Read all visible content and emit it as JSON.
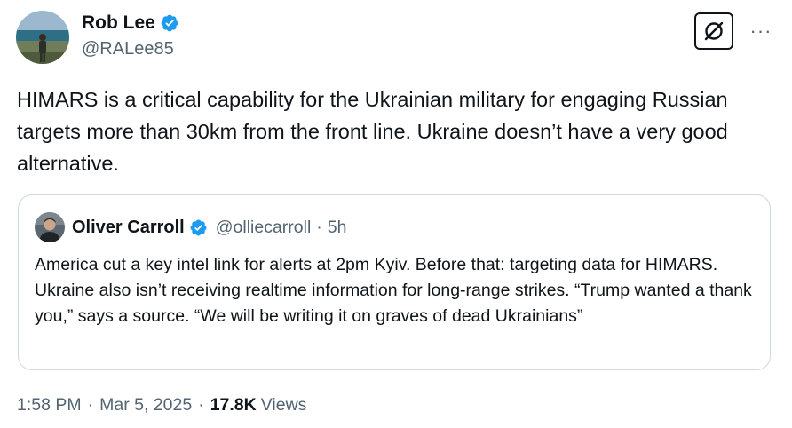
{
  "author": {
    "display_name": "Rob Lee",
    "handle": "@RALee85",
    "verified": true,
    "avatar_icon": "profile-photo-person-on-beach"
  },
  "actions": {
    "grok_icon": "grok-icon",
    "more_label": "···"
  },
  "tweet": {
    "text": "HIMARS is a critical capability for the Ukrainian military for engaging Russian targets more than 30km from the front line. Ukraine doesn’t have a very good alternative."
  },
  "quote": {
    "display_name": "Oliver Carroll",
    "handle": "@olliecarroll",
    "separator": "·",
    "time": "5h",
    "verified": true,
    "avatar_icon": "profile-photo-man",
    "text": "America cut a key intel link for alerts at 2pm Kyiv. Before that: targeting data for HIMARS. Ukraine also isn’t receiving realtime information for long-range strikes. “Trump wanted a thank you,” says a source. “We will be writing it on graves of dead Ukrainians”"
  },
  "meta": {
    "time": "1:58 PM",
    "separator": "·",
    "date": "Mar 5, 2025",
    "views_count": "17.8K",
    "views_label": "Views"
  },
  "colors": {
    "text_primary": "#0f1419",
    "text_secondary": "#536471",
    "verified_blue": "#1d9bf0",
    "border": "#cfd9de"
  }
}
